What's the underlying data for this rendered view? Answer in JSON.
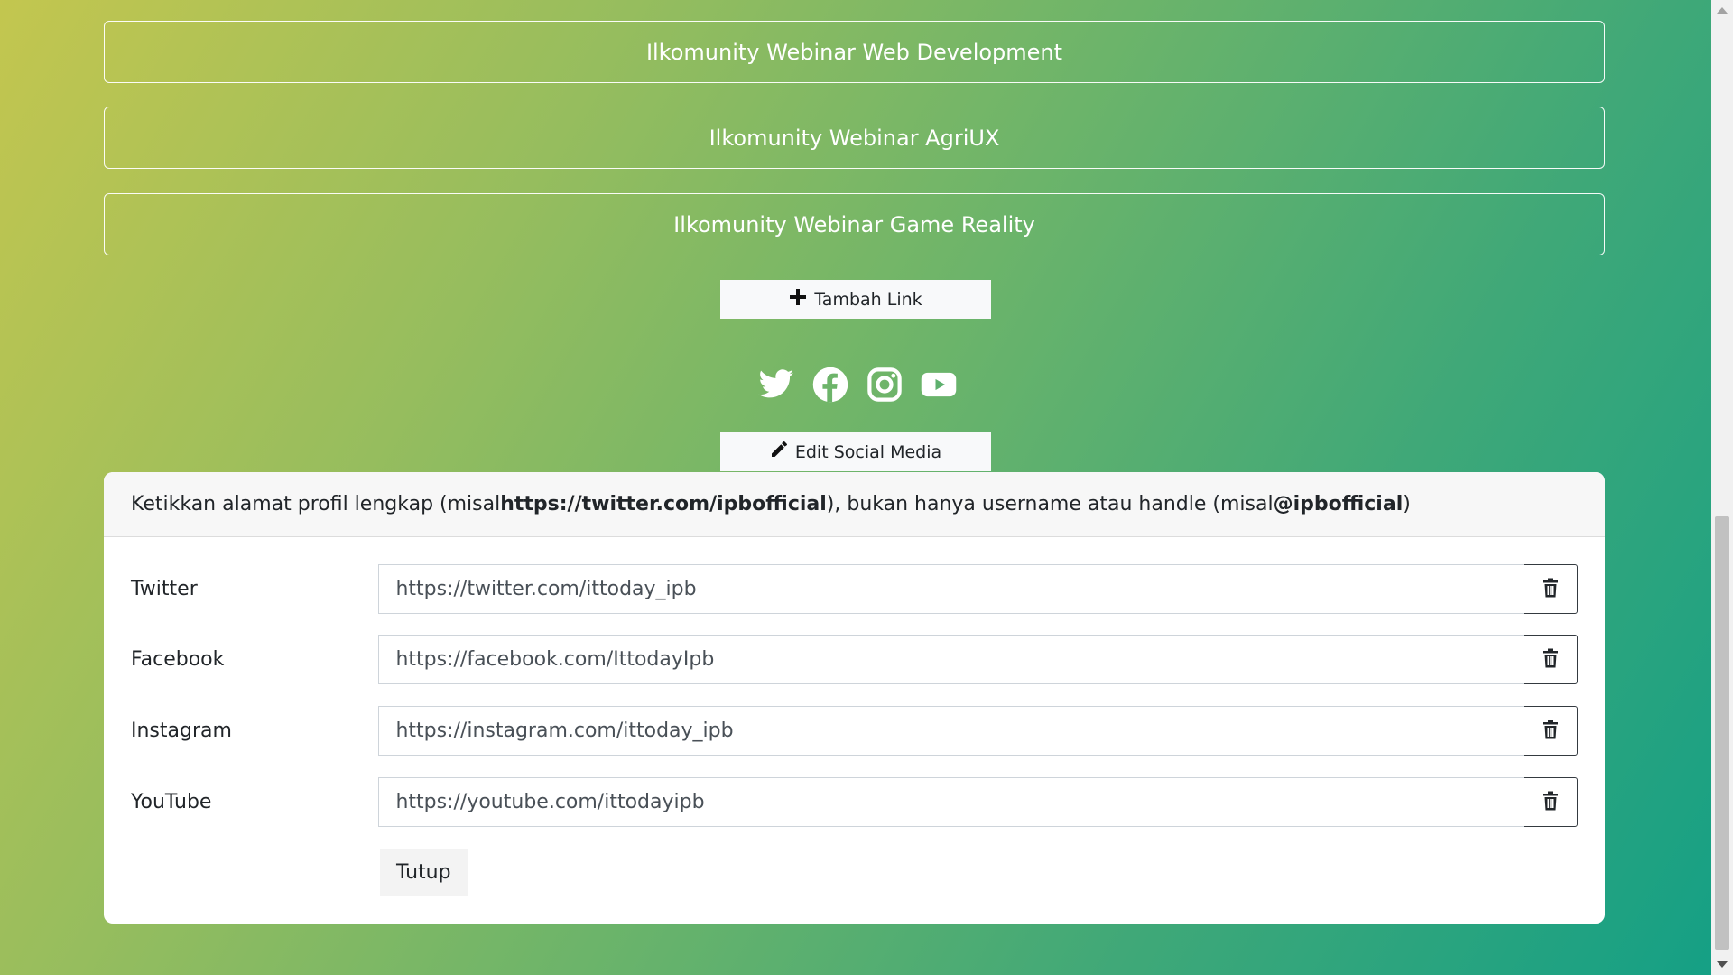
{
  "links": [
    {
      "label": "Ilkomunity Webinar Web Development"
    },
    {
      "label": "Ilkomunity Webinar AgriUX"
    },
    {
      "label": "Ilkomunity Webinar Game Reality"
    }
  ],
  "add_link_button": {
    "label": "Tambah Link",
    "icon": "plus-icon"
  },
  "social_icons": [
    "twitter-icon",
    "facebook-icon",
    "instagram-icon",
    "youtube-icon"
  ],
  "edit_social_button": {
    "label": "Edit Social Media",
    "icon": "pencil-icon"
  },
  "social_form": {
    "hint_prefix": "Ketikkan alamat profil lengkap (misal ",
    "hint_example_url": "https://twitter.com/ipbofficial",
    "hint_middle": "), bukan hanya username atau handle (misal ",
    "hint_example_handle": "@ipbofficial",
    "hint_suffix": ")",
    "fields": [
      {
        "label": "Twitter",
        "value": "https://twitter.com/ittoday_ipb"
      },
      {
        "label": "Facebook",
        "value": "https://facebook.com/IttodayIpb"
      },
      {
        "label": "Instagram",
        "value": "https://instagram.com/ittoday_ipb"
      },
      {
        "label": "YouTube",
        "value": "https://youtube.com/ittodayipb"
      }
    ],
    "close_label": "Tutup"
  },
  "colors": {
    "gradient_start": "#c3c64f",
    "gradient_end": "#15a085",
    "icon": "#ffffff"
  }
}
